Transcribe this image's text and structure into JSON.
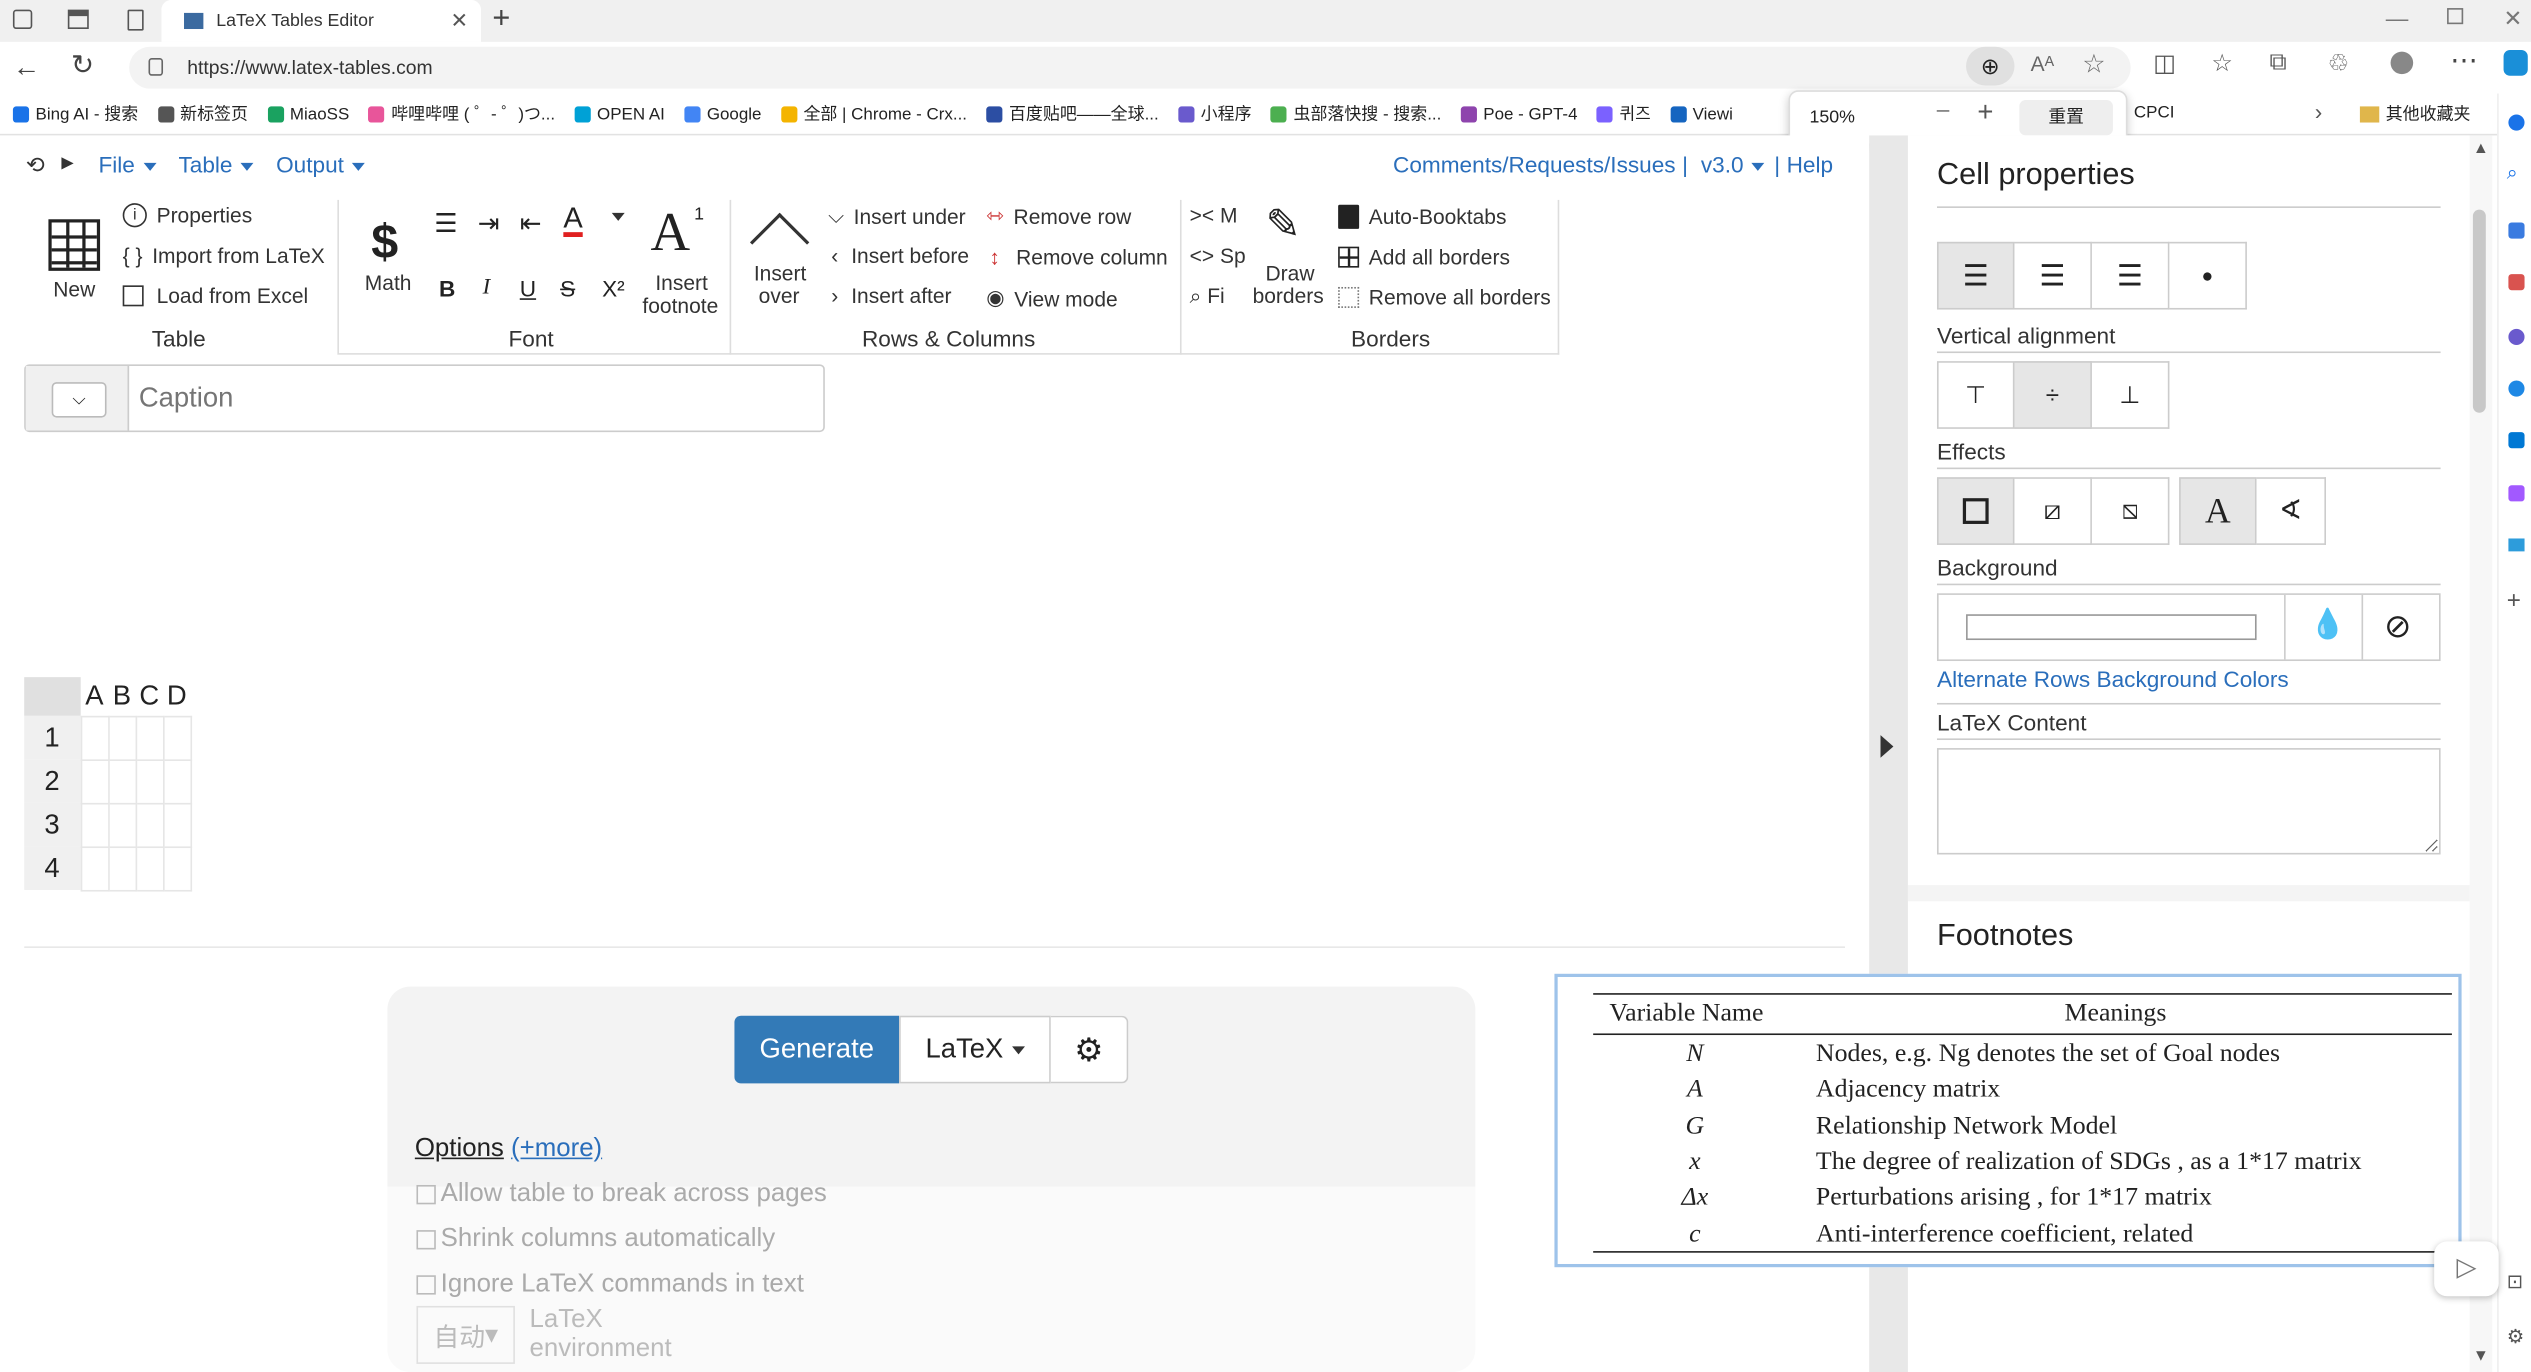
{
  "browser": {
    "tab_title": "LaTeX Tables Editor",
    "url": "https://www.latex-tables.com",
    "zoom": {
      "value": "150%",
      "reset_label": "重置"
    },
    "bookmarks": [
      "Bing AI - 搜索",
      "新标签页",
      "MiaoSS",
      "哔哩哔哩 ( ゜- ゜)つ...",
      "OPEN AI",
      "Google",
      "全部 | Chrome - Crx...",
      "百度贴吧——全球...",
      "小程序",
      "虫部落快搜 - 搜索...",
      "Poe - GPT-4",
      "퀴즈",
      "Viewi"
    ],
    "bookmarks_right": [
      "CPCI",
      "其他收藏夹"
    ]
  },
  "menu": {
    "file": "File",
    "table": "Table",
    "output": "Output",
    "comments": "Comments/Requests/Issues",
    "pipe": "|",
    "version": "v3.0",
    "help": "Help"
  },
  "toolbar": {
    "new": "New",
    "properties": "Properties",
    "import": "Import from LaTeX",
    "load": "Load from Excel",
    "math": "Math",
    "insert_footnote_1": "Insert",
    "insert_footnote_2": "footnote",
    "footnote_sup": "1",
    "insert_over_1": "Insert",
    "insert_over_2": "over",
    "insert_under": "Insert under",
    "insert_before": "Insert before",
    "insert_after": "Insert after",
    "remove_row": "Remove row",
    "remove_column": "Remove column",
    "view_mode": "View mode",
    "m_trunc": "M",
    "s_trunc": "Sp",
    "f_trunc": "Fi",
    "draw_borders_1": "Draw",
    "draw_borders_2": "borders",
    "auto_booktabs": "Auto-Booktabs",
    "add_all_borders": "Add all borders",
    "remove_all_borders": "Remove all borders",
    "groups": {
      "table": "Table",
      "font": "Font",
      "rows_columns": "Rows & Columns",
      "borders": "Borders"
    }
  },
  "caption": {
    "placeholder": "Caption"
  },
  "grid": {
    "cols": [
      "A",
      "B",
      "C",
      "D"
    ],
    "rows": [
      "1",
      "2",
      "3",
      "4"
    ]
  },
  "generate": {
    "button": "Generate",
    "format": "LaTeX",
    "options": "Options",
    "more": "(+more)",
    "opts": [
      "Allow table to break across pages",
      "Shrink columns automatically",
      "Ignore LaTeX commands in text"
    ],
    "env_select": "自动",
    "env_label": "LaTeX environment"
  },
  "cell_props": {
    "title": "Cell properties",
    "valign": "Vertical alignment",
    "effects": "Effects",
    "background": "Background",
    "alt_rows": "Alternate Rows Background Colors",
    "latex_content": "LaTeX Content",
    "footnotes": "Footnotes"
  },
  "preview": {
    "headers": [
      "Variable Name",
      "Meanings"
    ],
    "rows": [
      [
        "N",
        "Nodes, e.g. Ng denotes the set of Goal nodes"
      ],
      [
        "A",
        "Adjacency matrix"
      ],
      [
        "G",
        "Relationship Network Model"
      ],
      [
        "x",
        "The degree of realization of SDGs , as a 1*17 matrix"
      ],
      [
        "Δx",
        "Perturbations arising , for 1*17 matrix"
      ],
      [
        "c",
        "Anti-interference coefficient, related"
      ]
    ]
  },
  "colors": {
    "accent": "#2a6ebb",
    "generate": "#337ab7"
  }
}
